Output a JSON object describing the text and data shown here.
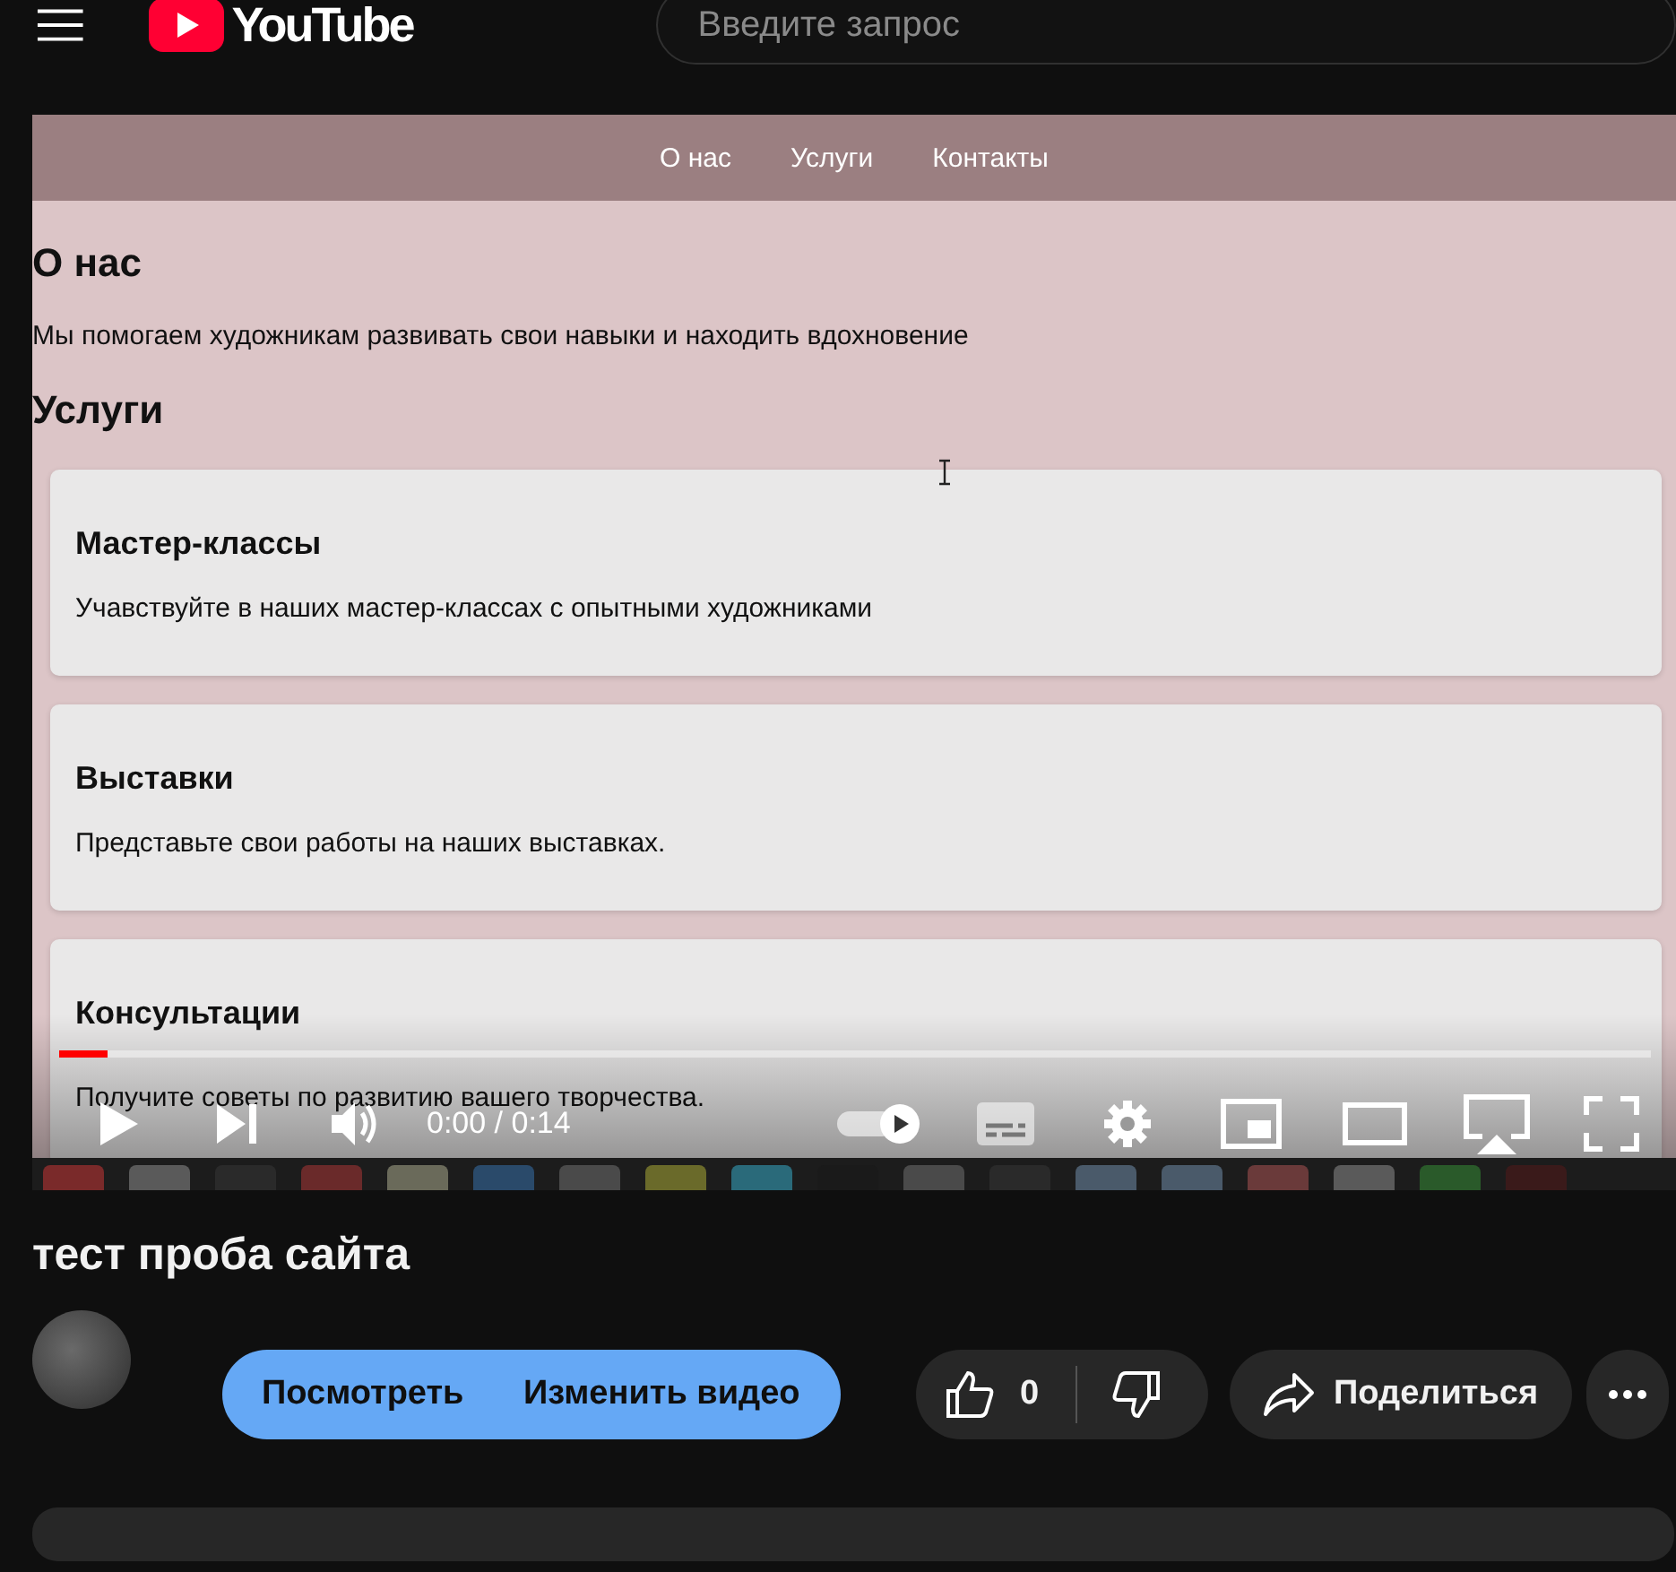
{
  "header": {
    "logo": "YouTube",
    "search": {
      "placeholder": "Введите запрос"
    }
  },
  "video": {
    "site": {
      "nav": [
        "О нас",
        "Услуги",
        "Контакты"
      ],
      "about_heading": "О нас",
      "about_text": "Мы помогаем художникам развивать свои навыки и находить вдохновение",
      "services_heading": "Услуги",
      "cards": [
        {
          "title": "Мастер-классы",
          "text": "Учавствуйте в наших мастер-классах с опытными художниками"
        },
        {
          "title": "Выставки",
          "text": "Представьте свои работы на наших выставках."
        },
        {
          "title": "Консультации",
          "text": "Получите советы по развитию вашего творчества."
        }
      ]
    },
    "progress": {
      "level": 0.03
    },
    "time": "0:00 / 0:14",
    "autoplay": {
      "on": true
    }
  },
  "title": "тест проба сайта",
  "actions": {
    "watch_button": "Посмотреть",
    "edit_button": "Изменить видео",
    "likes": "0",
    "share": "Поделиться"
  }
}
